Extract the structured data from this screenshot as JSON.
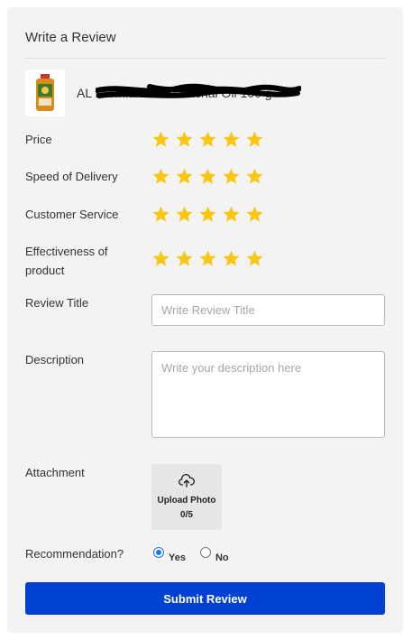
{
  "header": {
    "title": "Write a Review"
  },
  "product": {
    "name": "AL Premium Pure Sachal Oil 100 g"
  },
  "ratings": [
    {
      "label": "Price",
      "stars": 5
    },
    {
      "label": "Speed of Delivery",
      "stars": 5
    },
    {
      "label": "Customer Service",
      "stars": 5
    },
    {
      "label_line1": "Effectiveness of",
      "label_line2": "product",
      "stars": 5
    }
  ],
  "review_title": {
    "label": "Review Title",
    "placeholder": "Write Review Title",
    "value": ""
  },
  "description": {
    "label": "Description",
    "placeholder": "Write your description here",
    "value": ""
  },
  "attachment": {
    "label": "Attachment",
    "upload_label": "Upload Photo",
    "count": "0/5",
    "icon": "cloud-upload-icon"
  },
  "recommendation": {
    "label": "Recommendation?",
    "options": [
      {
        "label": "Yes",
        "checked": true
      },
      {
        "label": "No",
        "checked": false
      }
    ]
  },
  "submit": {
    "label": "Submit Review"
  },
  "colors": {
    "star": "#f8c613",
    "primary": "#0041d4",
    "card_bg": "#f3f3f3"
  }
}
